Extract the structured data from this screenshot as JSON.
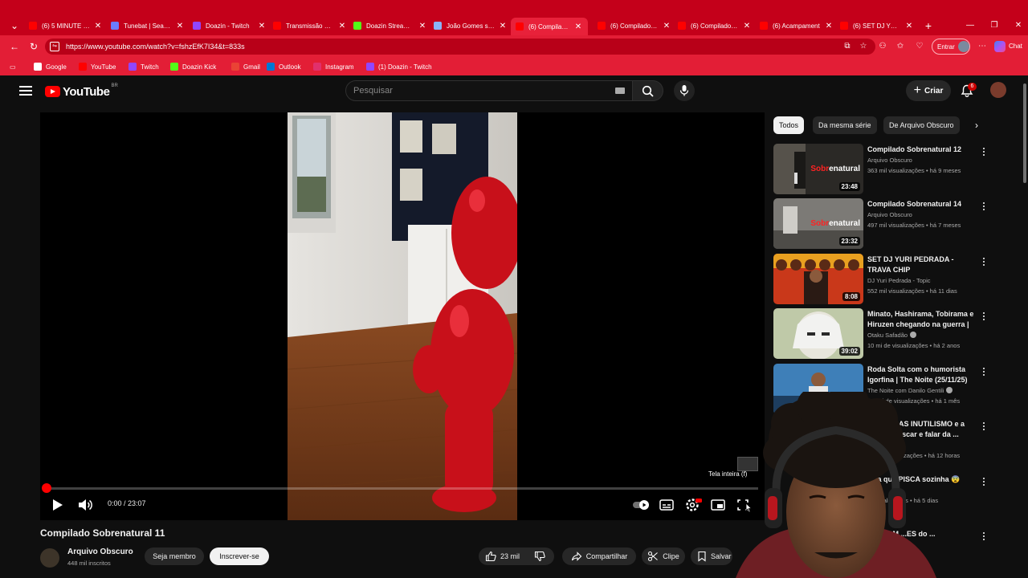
{
  "browser": {
    "tabs": [
      {
        "label": "(6) 5 MINUTE VOC",
        "favicon_color": "#ff0000",
        "active": false
      },
      {
        "label": "Tunebat | Search",
        "favicon_color": "#6b7cff",
        "active": false
      },
      {
        "label": "Doazin - Twitch",
        "favicon_color": "#9146ff",
        "active": false
      },
      {
        "label": "Transmissão ao vi",
        "favicon_color": "#ff0000",
        "active": false
      },
      {
        "label": "Doazin Stream - V",
        "favicon_color": "#53fc18",
        "active": false
      },
      {
        "label": "João Gomes se p",
        "favicon_color": "#8ab4f8",
        "active": false
      },
      {
        "label": "(6) Compilado Sc",
        "favicon_color": "#ff0000",
        "active": true
      },
      {
        "label": "(6) Compilado Sc",
        "favicon_color": "#ff0000",
        "active": false
      },
      {
        "label": "(6) Compilado Sc",
        "favicon_color": "#ff0000",
        "active": false
      },
      {
        "label": "(6) Acampament",
        "favicon_color": "#ff0000",
        "active": false
      },
      {
        "label": "(6) SET DJ YURI P",
        "favicon_color": "#ff0000",
        "active": false
      }
    ],
    "url": "https://www.youtube.com/watch?v=fshzEfK7I34&t=833s",
    "signin_label": "Entrar",
    "chat_label": "Chat",
    "bookmarks": [
      {
        "label": "Google",
        "favicon_color": "#ffffff"
      },
      {
        "label": "YouTube",
        "favicon_color": "#ff0000"
      },
      {
        "label": "Twitch",
        "favicon_color": "#9146ff"
      },
      {
        "label": "Doazin Kick",
        "favicon_color": "#53fc18"
      },
      {
        "label": "Gmail",
        "favicon_color": "#ea4335"
      },
      {
        "label": "Outlook",
        "favicon_color": "#0078d4"
      },
      {
        "label": "Instagram",
        "favicon_color": "#e1306c"
      },
      {
        "label": "(1) Doazin - Twitch",
        "favicon_color": "#9146ff"
      }
    ]
  },
  "youtube": {
    "logo_text": "YouTube",
    "country_code": "BR",
    "search_placeholder": "Pesquisar",
    "create_label": "Criar",
    "notification_count": "6",
    "player": {
      "time_display": "0:00 / 23:07",
      "progress_fraction": 0.005,
      "tooltip": "Tela inteira (f)"
    },
    "video": {
      "title": "Compilado Sobrenatural 11",
      "channel": "Arquivo Obscuro",
      "subscribers": "448 mil inscritos",
      "join_label": "Seja membro",
      "subscribe_label": "Inscrever-se",
      "likes": "23 mil",
      "share_label": "Compartilhar",
      "clip_label": "Clipe",
      "save_label": "Salvar"
    },
    "chips": [
      {
        "label": "Todos",
        "active": true
      },
      {
        "label": "Da mesma série",
        "active": false
      },
      {
        "label": "De Arquivo Obscuro",
        "active": false
      }
    ],
    "recommendations": [
      {
        "title": "Compilado Sobrenatural 12",
        "channel": "Arquivo Obscuro",
        "meta": "363 mil visualizações • há 9 meses",
        "duration": "23:48",
        "thumb": "dark-corridor",
        "thumb_text": "Sobrenatural"
      },
      {
        "title": "Compilado Sobrenatural 14",
        "channel": "Arquivo Obscuro",
        "meta": "497 mil visualizações • há 7 meses",
        "duration": "23:32",
        "thumb": "gray-room",
        "thumb_text": "Sobrenatural"
      },
      {
        "title": "SET DJ YURI PEDRADA - TRAVA CHIP",
        "channel": "DJ Yuri Pedrada - Topic",
        "meta": "552 mil visualizações • há 11 dias",
        "duration": "8:08",
        "thumb": "music-poster",
        "thumb_text": ""
      },
      {
        "title": "Minato, Hashirama, Tobirama e Hiruzen chegando na guerra | ...",
        "channel": "Otaku Safadão",
        "meta": "10 mi de visualizações • há 2 anos",
        "duration": "39:02",
        "thumb": "anime",
        "thumb_text": ""
      },
      {
        "title": "Roda Solta com o humorista Igorfina | The Noite (25/11/25)",
        "channel": "The Noite com Danilo Gentili",
        "meta": "1,2 mi de visualizações • há 1 mês",
        "duration": "",
        "thumb": "talk-show",
        "thumb_text": ""
      },
      {
        "title": "...i o LUCAS INUTILISMO e a ...A pra pescar e falar da ...",
        "channel": "...o Choquetta",
        "meta": "...4 mil visualizações • há 12 horas",
        "duration": "",
        "thumb": "hidden",
        "thumb_text": ""
      },
      {
        "title": "...ka que PISCA sozinha 😨",
        "channel": "",
        "meta": "...visualizações • há 5 dias",
        "duration": "",
        "thumb": "hidden",
        "thumb_text": ""
      },
      {
        "title": "...VELAM ...ES do ...",
        "channel": "",
        "meta": "",
        "duration": "",
        "thumb": "hidden",
        "thumb_text": ""
      }
    ]
  },
  "colors": {
    "browser_red": "#c4001a",
    "youtube_red": "#ff0000",
    "page_bg": "#0f0f0f"
  }
}
